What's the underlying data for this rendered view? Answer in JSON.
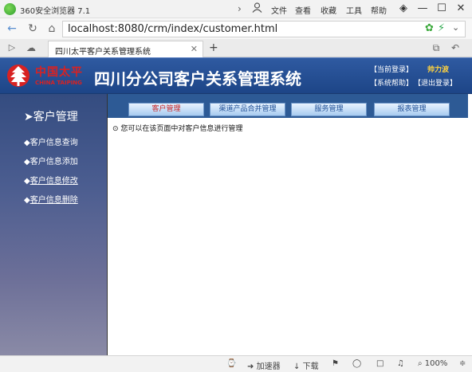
{
  "browser": {
    "app_title": "360安全浏览器 7.1",
    "menu": [
      "文件",
      "查看",
      "收藏",
      "工具",
      "帮助"
    ],
    "url": "localhost:8080/crm/index/customer.html",
    "tab_title": "四川太平客户关系管理系统",
    "status": {
      "accelerator": "加速器",
      "download": "下载",
      "zoom": "100%"
    }
  },
  "header": {
    "logo_cn": "中国太平",
    "logo_en": "CHINA TAIPING",
    "system_title": "四川分公司客户关系管理系统",
    "current_user_label": "【当前登录】",
    "current_user_name": "帅力波",
    "help_link": "【系统帮助】",
    "logout_link": "【退出登录】"
  },
  "sidebar": {
    "heading": "客户管理",
    "items": [
      {
        "label": "客户信息查询"
      },
      {
        "label": "客户信息添加"
      },
      {
        "label": "客户信息修改"
      },
      {
        "label": "客户信息删除"
      }
    ]
  },
  "topnav": {
    "tabs": [
      {
        "label": "客户管理"
      },
      {
        "label": "渠道产品合并管理"
      },
      {
        "label": "服务管理"
      },
      {
        "label": "报表管理"
      }
    ]
  },
  "content": {
    "message": "您可以在该页面中对客户信息进行管理"
  },
  "colors": {
    "header_blue": "#1d4587",
    "accent_red": "#d82222",
    "user_yellow": "#ffd23f",
    "tab_active_text": "#c81e1e"
  }
}
